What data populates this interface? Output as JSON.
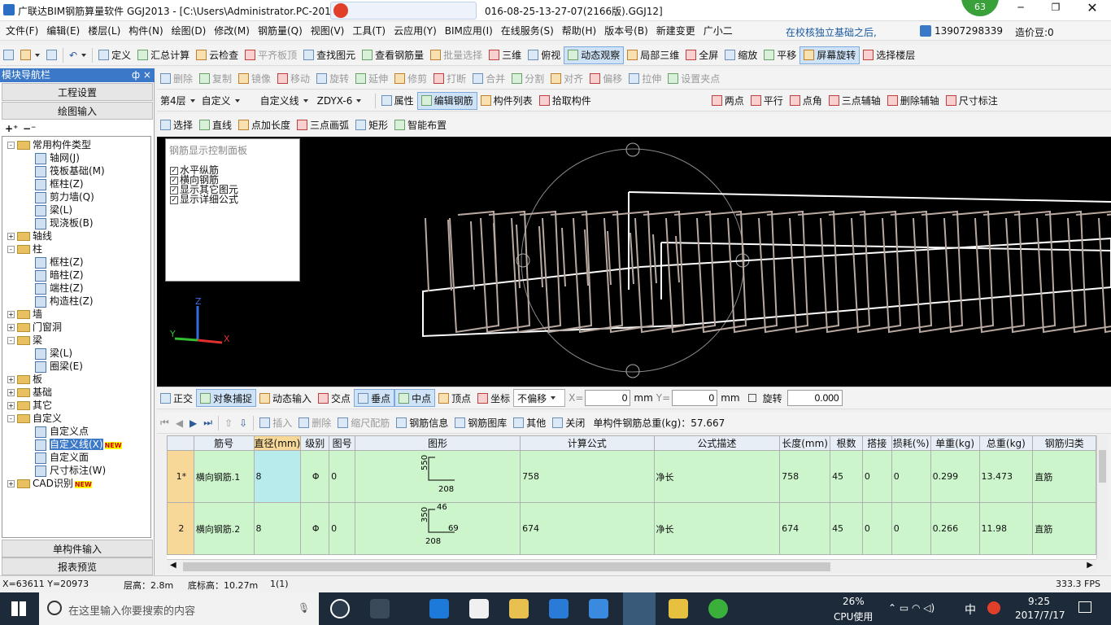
{
  "title": "广联达BIM钢筋算量软件 GGJ2013 - [C:\\Users\\Administrator.PC-2016",
  "title_right": "016-08-25-13-27-07(2166版).GGJ12]",
  "badge": "63",
  "menu": [
    "文件(F)",
    "编辑(E)",
    "楼层(L)",
    "构件(N)",
    "绘图(D)",
    "修改(M)",
    "钢筋量(Q)",
    "视图(V)",
    "工具(T)",
    "云应用(Y)",
    "BIM应用(I)",
    "在线服务(S)",
    "帮助(H)",
    "版本号(B)",
    "新建变更",
    "广小二"
  ],
  "menu_right": {
    "tip": "在校核独立基础之后,",
    "phone": "13907298339",
    "price": "造价豆:0"
  },
  "toolbar1": [
    "定义",
    "汇总计算",
    "云检查",
    "平齐板顶",
    "查找图元",
    "查看钢筋量",
    "批量选择",
    "三维",
    "俯视",
    "动态观察",
    "局部三维",
    "全屏",
    "缩放",
    "平移",
    "屏幕旋转",
    "选择楼层"
  ],
  "toolbar2": [
    "删除",
    "复制",
    "镜像",
    "移动",
    "旋转",
    "延伸",
    "修剪",
    "打断",
    "合并",
    "分割",
    "对齐",
    "偏移",
    "拉伸",
    "设置夹点"
  ],
  "toolbar3": {
    "floor": "第4层",
    "type": "自定义",
    "sub": "自定义线",
    "code": "ZDYX-6",
    "buttons": [
      "属性",
      "编辑钢筋",
      "构件列表",
      "拾取构件"
    ],
    "right": [
      "两点",
      "平行",
      "点角",
      "三点辅轴",
      "删除辅轴",
      "尺寸标注"
    ]
  },
  "toolbar4": [
    "选择",
    "直线",
    "点加长度",
    "三点画弧",
    "矩形",
    "智能布置"
  ],
  "nav": {
    "header": "模块导航栏",
    "pin": "ф ×",
    "btn1": "工程设置",
    "btn2": "绘图输入",
    "btn3": "单构件输入",
    "btn4": "报表预览"
  },
  "tree": [
    {
      "t": "常用构件类型",
      "lvl": 0,
      "tg": "-"
    },
    {
      "t": "轴网(J)",
      "lvl": 1
    },
    {
      "t": "筏板基础(M)",
      "lvl": 1
    },
    {
      "t": "框柱(Z)",
      "lvl": 1
    },
    {
      "t": "剪力墙(Q)",
      "lvl": 1
    },
    {
      "t": "梁(L)",
      "lvl": 1
    },
    {
      "t": "现浇板(B)",
      "lvl": 1
    },
    {
      "t": "轴线",
      "lvl": 0,
      "tg": "+"
    },
    {
      "t": "柱",
      "lvl": 0,
      "tg": "-"
    },
    {
      "t": "框柱(Z)",
      "lvl": 1
    },
    {
      "t": "暗柱(Z)",
      "lvl": 1
    },
    {
      "t": "端柱(Z)",
      "lvl": 1
    },
    {
      "t": "构造柱(Z)",
      "lvl": 1
    },
    {
      "t": "墙",
      "lvl": 0,
      "tg": "+"
    },
    {
      "t": "门窗洞",
      "lvl": 0,
      "tg": "+"
    },
    {
      "t": "梁",
      "lvl": 0,
      "tg": "-"
    },
    {
      "t": "梁(L)",
      "lvl": 1
    },
    {
      "t": "圈梁(E)",
      "lvl": 1
    },
    {
      "t": "板",
      "lvl": 0,
      "tg": "+"
    },
    {
      "t": "基础",
      "lvl": 0,
      "tg": "+"
    },
    {
      "t": "其它",
      "lvl": 0,
      "tg": "+"
    },
    {
      "t": "自定义",
      "lvl": 0,
      "tg": "-"
    },
    {
      "t": "自定义点",
      "lvl": 1
    },
    {
      "t": "自定义线(X)",
      "lvl": 1,
      "new": true,
      "sel": true
    },
    {
      "t": "自定义面",
      "lvl": 1
    },
    {
      "t": "尺寸标注(W)",
      "lvl": 1
    },
    {
      "t": "CAD识别",
      "lvl": 0,
      "tg": "+",
      "new": true
    }
  ],
  "control_panel": {
    "title": "钢筋显示控制面板",
    "items": [
      "水平纵筋",
      "横向钢筋",
      "显示其它图元",
      "显示详细公式"
    ]
  },
  "snap_bar": {
    "items": [
      "正交",
      "对象捕捉",
      "动态输入",
      "交点",
      "垂点",
      "中点",
      "顶点",
      "坐标"
    ],
    "offset": "不偏移",
    "x_label": "X=",
    "x_val": "0",
    "y_label": "Y=",
    "y_val": "0",
    "unit": "mm",
    "rot": "旋转",
    "rot_val": "0.000"
  },
  "grid_bar": {
    "items": [
      "插入",
      "删除",
      "缩尺配筋",
      "钢筋信息",
      "钢筋图库",
      "其他",
      "关闭"
    ],
    "total": "单构件钢筋总重(kg)：57.667"
  },
  "table": {
    "headers": [
      "筋号",
      "直径(mm)",
      "级别",
      "图号",
      "图形",
      "计算公式",
      "公式描述",
      "长度(mm)",
      "根数",
      "搭接",
      "损耗(%)",
      "单重(kg)",
      "总重(kg)",
      "钢筋归类"
    ],
    "rows": [
      {
        "n": "1*",
        "cells": [
          "横向钢筋.1",
          "8",
          "Φ",
          "0",
          "",
          "758",
          "净长",
          "758",
          "45",
          "0",
          "0",
          "0.299",
          "13.473",
          "直筋"
        ],
        "shape": {
          "a": "550",
          "b": "208"
        }
      },
      {
        "n": "2",
        "cells": [
          "横向钢筋.2",
          "8",
          "Φ",
          "0",
          "",
          "674",
          "净长",
          "674",
          "45",
          "0",
          "0",
          "0.266",
          "11.98",
          "直筋"
        ],
        "shape": {
          "a": "350",
          "b": "46",
          "c": "69",
          "d": "208"
        }
      }
    ]
  },
  "status": {
    "coord": "X=63611 Y=20973",
    "floor_h": "层高：2.8m",
    "bottom": "底标高：10.27m",
    "page": "1(1)",
    "fps": "333.3 FPS"
  },
  "taskbar": {
    "search": "在这里输入你要搜索的内容",
    "cpu_pct": "26%",
    "cpu": "CPU使用",
    "ime": "中",
    "time": "9:25",
    "date": "2017/7/17"
  },
  "colors": {
    "accent": "#3b78c8",
    "grid_row": "#ccf5cc",
    "taskbar": "#1c2a3a"
  }
}
